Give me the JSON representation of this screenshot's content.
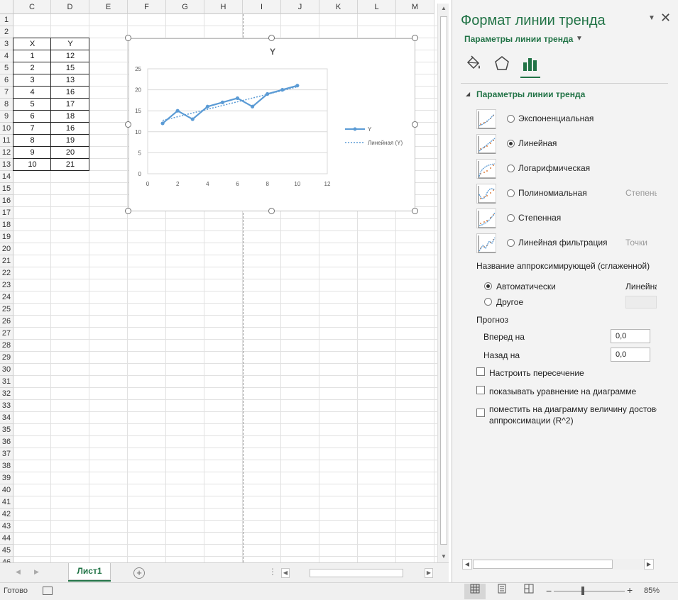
{
  "columns": [
    "C",
    "D",
    "E",
    "F",
    "G",
    "H",
    "I",
    "J",
    "K",
    "L",
    "M"
  ],
  "rows": [
    "1",
    "2",
    "3",
    "4",
    "5",
    "6",
    "7",
    "8",
    "9",
    "10",
    "11",
    "12",
    "13",
    "14",
    "15",
    "16",
    "17",
    "18",
    "19",
    "20",
    "21",
    "22",
    "23",
    "24",
    "25",
    "26",
    "27",
    "28",
    "29",
    "30",
    "31",
    "32",
    "33",
    "34",
    "35",
    "36",
    "37",
    "38",
    "39",
    "40",
    "41",
    "42",
    "43",
    "44",
    "45",
    "46"
  ],
  "table": {
    "headers": [
      "X",
      "Y"
    ],
    "cells": [
      [
        "1",
        "12"
      ],
      [
        "2",
        "15"
      ],
      [
        "3",
        "13"
      ],
      [
        "4",
        "16"
      ],
      [
        "5",
        "17"
      ],
      [
        "6",
        "18"
      ],
      [
        "7",
        "16"
      ],
      [
        "8",
        "19"
      ],
      [
        "9",
        "20"
      ],
      [
        "10",
        "21"
      ]
    ]
  },
  "chart_data": {
    "type": "line",
    "title": "Y",
    "x": [
      1,
      2,
      3,
      4,
      5,
      6,
      7,
      8,
      9,
      10
    ],
    "series": [
      {
        "name": "Y",
        "values": [
          12,
          15,
          13,
          16,
          17,
          18,
          16,
          19,
          20,
          21
        ]
      }
    ],
    "trendline": {
      "name": "Линейная (Y)",
      "type": "linear"
    },
    "xlim": [
      0,
      12
    ],
    "ylim": [
      0,
      25
    ],
    "xticks": [
      "0",
      "2",
      "4",
      "6",
      "8",
      "10",
      "12"
    ],
    "yticks": [
      "0",
      "5",
      "10",
      "15",
      "20",
      "25"
    ],
    "grid": true,
    "legend": "right",
    "colors": {
      "series": "#5b9bd5",
      "trend": "#5b9bd5"
    }
  },
  "sheet": {
    "tab_label": "Лист1",
    "add_label": "+"
  },
  "status": {
    "ready": "Готово",
    "zoom": "85%"
  },
  "pane": {
    "title": "Формат линии тренда",
    "subtitle": "Параметры линии тренда",
    "section_title": "Параметры линии тренда",
    "trend_types": [
      {
        "label": "Экспоненциальная",
        "extra": "",
        "selected": false
      },
      {
        "label": "Линейная",
        "extra": "",
        "selected": true
      },
      {
        "label": "Логарифмическая",
        "extra": "",
        "selected": false
      },
      {
        "label": "Полиномиальная",
        "extra": "Степень",
        "selected": false
      },
      {
        "label": "Степенная",
        "extra": "",
        "selected": false
      },
      {
        "label": "Линейная фильтрация",
        "extra": "Точки",
        "selected": false
      }
    ],
    "name_label": "Название аппроксимирующей (сглаженной)",
    "auto_label": "Автоматически",
    "auto_value": "Линейная",
    "other_label": "Другое",
    "forecast_label": "Прогноз",
    "forward_label": "Вперед на",
    "forward_value": "0,0",
    "backward_label": "Назад на",
    "backward_value": "0,0",
    "intercept_label": "Настроить пересечение",
    "equation_label": "показывать уравнение на диаграмме",
    "rsquared_label_1": "поместить на диаграмму величину достоверности",
    "rsquared_label_2": "аппроксимации (R^2)"
  },
  "colors": {
    "accent": "#217346"
  }
}
